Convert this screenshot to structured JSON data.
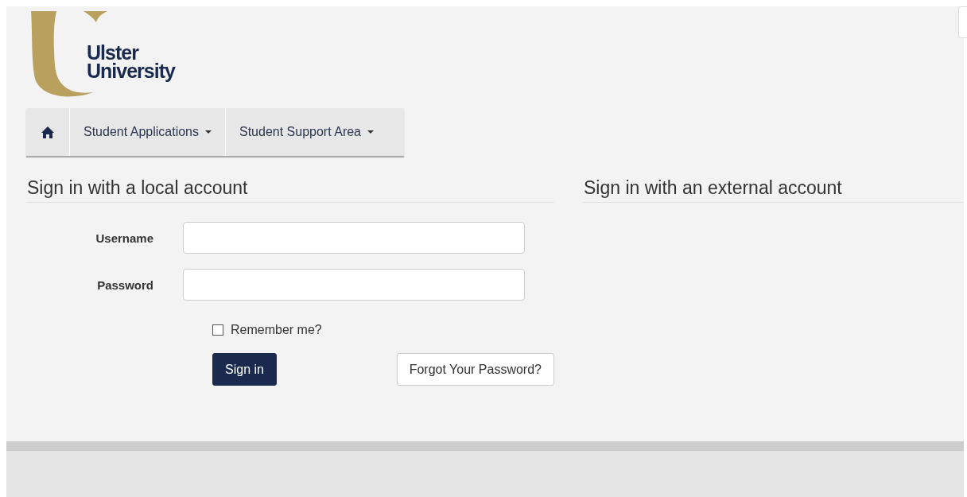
{
  "logo": {
    "lines": [
      "Ulster",
      "University"
    ]
  },
  "nav": {
    "items": [
      {
        "kind": "home"
      },
      {
        "kind": "dropdown",
        "label": "Student Applications"
      },
      {
        "kind": "dropdown",
        "label": "Student Support Area"
      }
    ]
  },
  "local": {
    "heading": "Sign in with a local account",
    "fields": [
      {
        "label": "Username"
      },
      {
        "label": "Password"
      }
    ],
    "remember": {
      "label": "Remember me?",
      "checked": false
    },
    "sign_in": "Sign in",
    "forgot": "Forgot Your Password?"
  },
  "external": {
    "heading": "Sign in with an external account"
  }
}
